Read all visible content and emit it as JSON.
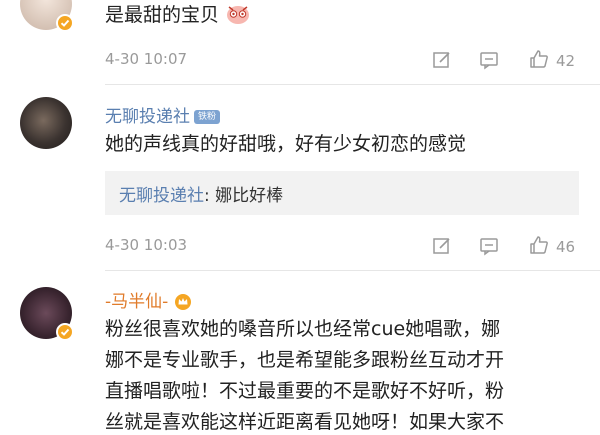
{
  "comments": [
    {
      "text": "是最甜的宝贝",
      "time": "4-30 10:07",
      "likes": "42"
    },
    {
      "username": "无聊投递社",
      "badge": "铁粉",
      "text": "她的声线真的好甜哦，好有少女初恋的感觉",
      "reply_name": "无聊投递社",
      "reply_text": ": 娜比好棒",
      "time": "4-30 10:03",
      "likes": "46"
    },
    {
      "username": "-马半仙-",
      "lines": [
        "粉丝很喜欢她的嗓音所以也经常cue她唱歌，娜",
        "娜不是专业歌手，也是希望能多跟粉丝互动才开",
        "直播唱歌啦！不过最重要的不是歌好不好听，粉",
        "丝就是喜欢能这样近距离看见她呀！如果大家不"
      ]
    }
  ],
  "colors": {
    "link": "#5a7fb0",
    "meta": "#9a9a9a",
    "verified": "#f5a623"
  },
  "icons": [
    "edit-icon",
    "comment-icon",
    "like-icon",
    "verified-icon",
    "emoji-icon"
  ]
}
